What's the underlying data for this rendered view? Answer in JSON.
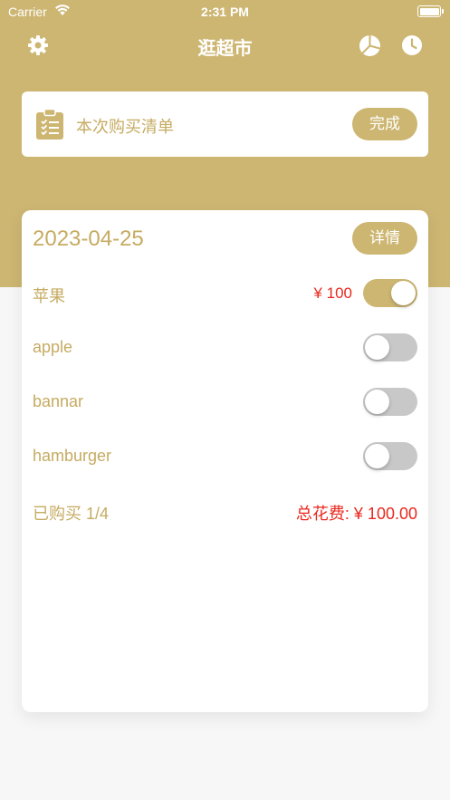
{
  "status_bar": {
    "carrier": "Carrier",
    "time": "2:31 PM",
    "icons": [
      "wifi-icon",
      "battery-icon"
    ]
  },
  "nav": {
    "title": "逛超市",
    "left_icon": "gear-icon",
    "right_icons": [
      "pie-chart-icon",
      "clock-icon"
    ]
  },
  "shopping_list": {
    "icon": "clipboard-checklist-icon",
    "title": "本次购买清单",
    "done_label": "完成"
  },
  "record": {
    "date": "2023-04-25",
    "detail_label": "详情",
    "items": [
      {
        "name": "苹果",
        "price": "¥ 100",
        "purchased": true
      },
      {
        "name": "apple",
        "price": "",
        "purchased": false
      },
      {
        "name": "bannar",
        "price": "",
        "purchased": false
      },
      {
        "name": "hamburger",
        "price": "",
        "purchased": false
      }
    ],
    "purchased_summary": "已购买 1/4",
    "total_label": "总花费: ¥ 100.00"
  },
  "colors": {
    "brand": "#cdb672",
    "text_gold": "#c6ab62",
    "price_red": "#e8281e",
    "toggle_off": "#c8c8c8"
  }
}
